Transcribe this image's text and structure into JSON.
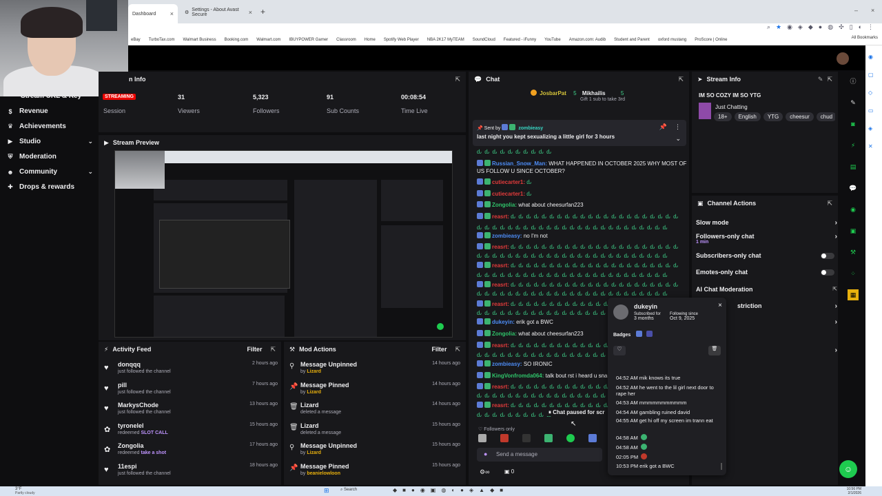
{
  "browser": {
    "tabs": [
      {
        "label": "Dashboard",
        "active": true
      },
      {
        "label": "Settings - About Avast Secure",
        "active": false
      }
    ],
    "bookmarks": [
      "eBay",
      "TurboTax.com",
      "Walmart Business",
      "Booking.com",
      "Walmart.com",
      "IBUYPOWER Gamer",
      "Classroom",
      "Home",
      "Spotify Web Player",
      "NBA 2K17 MyTEAM",
      "SoundCloud",
      "Featured - iFunny",
      "YouTube",
      "Amazon.com: Audib",
      "Student and Parent",
      "oxford mustang",
      "ProScore | Online"
    ],
    "all_bookmarks": "All Bookmarks"
  },
  "sidebar": {
    "partial_item": "Stream URL & Key",
    "items": [
      {
        "label": "Revenue",
        "icon": "dollar-icon",
        "chev": ""
      },
      {
        "label": "Achievements",
        "icon": "trophy-icon",
        "chev": ""
      },
      {
        "label": "Studio",
        "icon": "film-icon",
        "chev": "⌄"
      },
      {
        "label": "Moderation",
        "icon": "shield-icon",
        "chev": ""
      },
      {
        "label": "Community",
        "icon": "people-icon",
        "chev": "⌄"
      },
      {
        "label": "Drops & rewards",
        "icon": "gift-icon",
        "chev": ""
      }
    ]
  },
  "session": {
    "title": "Session Info",
    "title_visible": "n Info",
    "live_badge": "STREAMING",
    "session_label": "Session",
    "stats": [
      {
        "value": "31",
        "label": "Viewers"
      },
      {
        "value": "5,323",
        "label": "Followers"
      },
      {
        "value": "91",
        "label": "Sub Counts"
      },
      {
        "value": "00:08:54",
        "label": "Time Live"
      }
    ]
  },
  "preview": {
    "title": "Stream Preview"
  },
  "activity": {
    "title": "Activity Feed",
    "filter": "Filter",
    "rows": [
      {
        "name": "donqqq",
        "sub": "just followed the channel",
        "hl": "",
        "time": "2 hours ago",
        "icon": "heart-icon"
      },
      {
        "name": "pill",
        "sub": "just followed the channel",
        "hl": "",
        "time": "7 hours ago",
        "icon": "heart-icon"
      },
      {
        "name": "MarkysChode",
        "sub": "just followed the channel",
        "hl": "",
        "time": "13 hours ago",
        "icon": "heart-icon"
      },
      {
        "name": "tyronelel",
        "sub": "redeemed",
        "hl": "SLOT CALL",
        "time": "15 hours ago",
        "icon": "points-icon"
      },
      {
        "name": "Zongolia",
        "sub": "redeemed",
        "hl": "take a shot",
        "time": "17 hours ago",
        "icon": "points-icon"
      },
      {
        "name": "11espi",
        "sub": "just followed the channel",
        "hl": "",
        "time": "18 hours ago",
        "icon": "heart-icon"
      }
    ]
  },
  "mod_actions": {
    "title": "Mod Actions",
    "filter": "Filter",
    "rows": [
      {
        "name": "Message Unpinned",
        "pre": "by",
        "hl": "Lizard",
        "time": "14 hours ago",
        "icon": "unpin-icon"
      },
      {
        "name": "Message Pinned",
        "pre": "by",
        "hl": "Lizard",
        "time": "14 hours ago",
        "icon": "pin-icon"
      },
      {
        "name": "Lizard",
        "pre": "deleted a message",
        "hl": "",
        "time": "14 hours ago",
        "icon": "trash-icon"
      },
      {
        "name": "Lizard",
        "pre": "deleted a message",
        "hl": "",
        "time": "15 hours ago",
        "icon": "trash-icon"
      },
      {
        "name": "Message Unpinned",
        "pre": "by",
        "hl": "Lizard",
        "time": "15 hours ago",
        "icon": "unpin-icon"
      },
      {
        "name": "Message Pinned",
        "pre": "by",
        "hl": "beanielowloon",
        "time": "15 hours ago",
        "icon": "pin-icon"
      }
    ]
  },
  "chat": {
    "title": "Chat",
    "hype": {
      "user1": "JosbarPat",
      "count1": "5",
      "user2": "Mikhailis",
      "count2": "5",
      "gift": "Gift 1 sub to take 3rd"
    },
    "pinned": {
      "sent_by": "Sent by",
      "user": "zombieasy",
      "text": "last night you kept sexualizing a little girl for 3 hours"
    },
    "messages": [
      {
        "user": "",
        "cls": "",
        "text": "",
        "emotes": "ԃ ԃ ԃ ԃ ԃ ԃ ԃ ԃ ԃ ԃ"
      },
      {
        "user": "Russian_Snow_Man:",
        "cls": "u-blue",
        "text": "WHAT HAPPENED IN OCTOBER 2025 WHY MOST OF",
        "emotes": ""
      },
      {
        "user": "",
        "cls": "",
        "text": "US FOLLOW U SINCE OCTOBER?",
        "emotes": ""
      },
      {
        "user": "cutiecarter1:",
        "cls": "u-red",
        "text": "",
        "emotes": "ԃ"
      },
      {
        "user": "cutiecarter1:",
        "cls": "u-red",
        "text": "",
        "emotes": "ԃ"
      },
      {
        "user": "Zongolia:",
        "cls": "u-green",
        "text": "what about cheesurfan223",
        "emotes": ""
      },
      {
        "user": "reasrt:",
        "cls": "u-red",
        "text": "",
        "emotes": "ԃ ԃ ԃ ԃ ԃ ԃ ԃ ԃ ԃ ԃ ԃ ԃ ԃ ԃ ԃ ԃ ԃ ԃ ԃ ԃ ԃ ԃ"
      },
      {
        "user": "",
        "cls": "",
        "text": "",
        "emotes": "ԃ ԃ ԃ ԃ ԃ ԃ ԃ ԃ ԃ ԃ ԃ ԃ ԃ ԃ ԃ ԃ ԃ ԃ ԃ ԃ ԃ ԃ ԃ ԃ ԃ"
      },
      {
        "user": "zombieasy:",
        "cls": "u-blue",
        "text": "no I'm not",
        "emotes": ""
      },
      {
        "user": "reasrt:",
        "cls": "u-red",
        "text": "",
        "emotes": "ԃ ԃ ԃ ԃ ԃ ԃ ԃ ԃ ԃ ԃ ԃ ԃ ԃ ԃ ԃ ԃ ԃ ԃ ԃ ԃ ԃ ԃ"
      },
      {
        "user": "",
        "cls": "",
        "text": "",
        "emotes": "ԃ ԃ ԃ ԃ ԃ ԃ ԃ ԃ ԃ ԃ ԃ ԃ ԃ ԃ ԃ ԃ ԃ ԃ ԃ ԃ ԃ ԃ ԃ ԃ ԃ"
      },
      {
        "user": "reasrt:",
        "cls": "u-red",
        "text": "",
        "emotes": "ԃ ԃ ԃ ԃ ԃ ԃ ԃ ԃ ԃ ԃ ԃ ԃ ԃ ԃ ԃ ԃ ԃ ԃ ԃ ԃ ԃ ԃ"
      },
      {
        "user": "",
        "cls": "",
        "text": "",
        "emotes": "ԃ ԃ ԃ ԃ ԃ ԃ ԃ ԃ ԃ ԃ ԃ ԃ ԃ ԃ ԃ ԃ ԃ ԃ ԃ ԃ ԃ ԃ ԃ ԃ ԃ"
      },
      {
        "user": "reasrt:",
        "cls": "u-red",
        "text": "",
        "emotes": "ԃ ԃ ԃ ԃ ԃ ԃ ԃ ԃ ԃ ԃ ԃ ԃ ԃ ԃ ԃ ԃ ԃ ԃ ԃ ԃ ԃ ԃ"
      },
      {
        "user": "",
        "cls": "",
        "text": "",
        "emotes": "ԃ ԃ ԃ ԃ ԃ ԃ ԃ ԃ ԃ ԃ ԃ ԃ ԃ ԃ ԃ ԃ ԃ ԃ ԃ ԃ ԃ ԃ ԃ ԃ ԃ"
      },
      {
        "user": "reasrt:",
        "cls": "u-red",
        "text": "",
        "emotes": "ԃ ԃ ԃ ԃ ԃ ԃ ԃ ԃ ԃ ԃ ԃ ԃ ԃ ԃ ԃ ԃ ԃ ԃ ԃ ԃ ԃ ԃ"
      },
      {
        "user": "",
        "cls": "",
        "text": "",
        "emotes": "ԃ ԃ ԃ ԃ ԃ ԃ ԃ ԃ ԃ ԃ ԃ ԃ ԃ ԃ ԃ ԃ ԃ ԃ ԃ ԃ ԃ ԃ ԃ ԃ ԃ"
      },
      {
        "user": "dukeyin:",
        "cls": "u-blue",
        "text": "erik got a BWC",
        "emotes": ""
      },
      {
        "user": "Zongolia:",
        "cls": "u-green",
        "text": "what about cheesurfan223",
        "emotes": ""
      },
      {
        "user": "reasrt:",
        "cls": "u-red",
        "text": "",
        "emotes": "ԃ ԃ ԃ ԃ ԃ ԃ ԃ ԃ ԃ ԃ ԃ ԃ ԃ ԃ ԃ ԃ ԃ ԃ ԃ ԃ ԃ ԃ"
      },
      {
        "user": "",
        "cls": "",
        "text": "",
        "emotes": "ԃ ԃ ԃ ԃ ԃ ԃ ԃ ԃ ԃ ԃ ԃ ԃ ԃ ԃ ԃ ԃ ԃ ԃ ԃ ԃ ԃ ԃ ԃ ԃ ԃ"
      },
      {
        "user": "zombieasy:",
        "cls": "u-blue",
        "text": "SO IRONIC",
        "emotes": ""
      },
      {
        "user": "KingVonfromda064:",
        "cls": "u-green",
        "text": "talk bout rst i heard u snake",
        "emotes": ""
      },
      {
        "user": "reasrt:",
        "cls": "u-red",
        "text": "",
        "emotes": "ԃ ԃ ԃ ԃ ԃ ԃ ԃ ԃ ԃ ԃ ԃ ԃ ԃ ԃ ԃ ԃ ԃ ԃ ԃ ԃ ԃ ԃ"
      },
      {
        "user": "",
        "cls": "",
        "text": "",
        "emotes": "ԃ ԃ ԃ ԃ ԃ ԃ ԃ ԃ ԃ ԃ ԃ ԃ ԃ ԃ ԃ ԃ ԃ ԃ ԃ ԃ ԃ ԃ ԃ ԃ ԃ"
      },
      {
        "user": "reasrt:",
        "cls": "u-red",
        "text": "",
        "emotes": "ԃ ԃ ԃ ԃ ԃ ԃ ԃ ԃ ԃ ԃ ԃ ԃ ԃ ԃ ԃ ԃ ԃ ԃ ԃ ԃ ԃ ԃ"
      },
      {
        "user": "",
        "cls": "",
        "text": "",
        "emotes": "ԃ ԃ ԃ ԃ ԃ ԃ ԃ ԃ ԃ ԃ"
      }
    ],
    "paused": "Chat paused for scr",
    "followers_only": "Followers only",
    "send_placeholder": "Send a message",
    "points": "0"
  },
  "user_card": {
    "name": "dukeyin",
    "subscribed_label": "Subscribed for",
    "subscribed_value": "3 months",
    "following_label": "Following since",
    "following_value": "Oct 9, 2025",
    "badges_label": "Badges",
    "log": [
      "04:52 AM mik knows its true",
      "04:52 AM he went to the lil girl next door to rape her",
      "04:53 AM mmmmmmmmmmm",
      "04:54 AM gambling ruined david",
      "04:55 AM get hi off my screen im trann eat",
      "04:58 AM",
      "04:58 AM",
      "02:05 PM",
      "10:53 PM erik got a BWC"
    ]
  },
  "stream_info": {
    "title": "Stream Info",
    "stream_title": "IM SO COZY IM SO YTG",
    "category": "Just Chatting",
    "tags": [
      "18+",
      "English",
      "YTG",
      "cheesur",
      "chud"
    ]
  },
  "channel_actions": {
    "title": "Channel Actions",
    "rows": [
      {
        "label": "Slow mode",
        "sub": "",
        "control": "arrow"
      },
      {
        "label": "Followers-only chat",
        "sub": "1 min",
        "control": "arrow"
      },
      {
        "label": "Subscribers-only chat",
        "sub": "",
        "control": "toggle"
      },
      {
        "label": "Emotes-only chat",
        "sub": "",
        "control": "toggle"
      },
      {
        "label": "AI Chat Moderation",
        "sub": "",
        "control": "none"
      }
    ],
    "partial": "striction"
  },
  "taskbar": {
    "weather": "3°F",
    "weather_sub": "Partly cloudy",
    "search": "Search",
    "time": "10:56 PM",
    "date": "2/1/2026"
  }
}
